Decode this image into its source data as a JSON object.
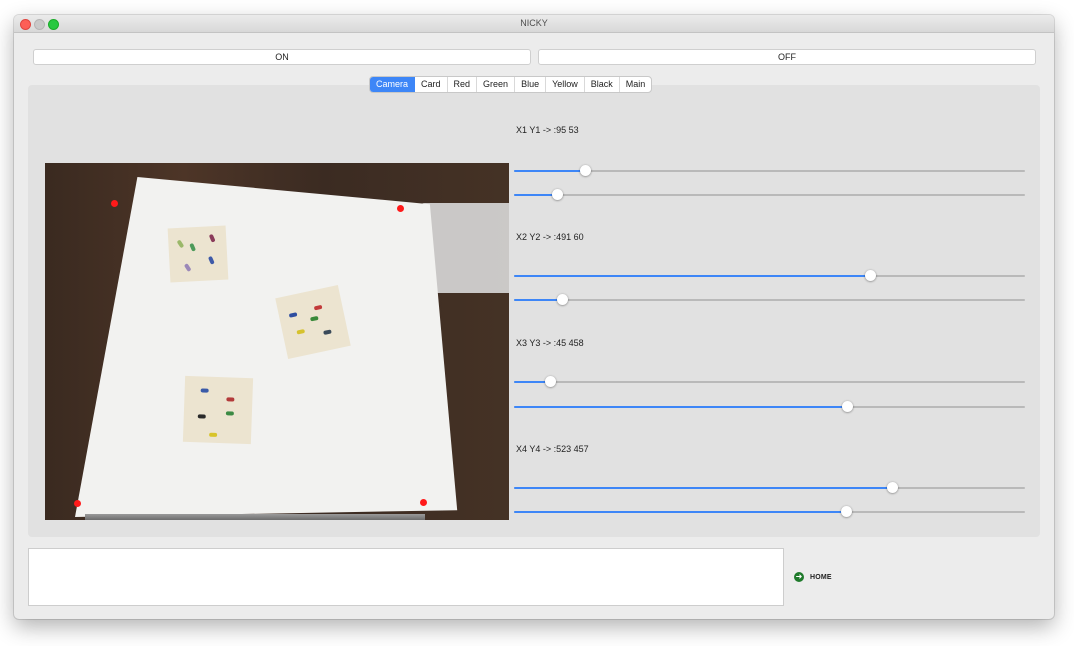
{
  "window": {
    "title": "NICKY"
  },
  "buttons": {
    "on_label": "ON",
    "off_label": "OFF"
  },
  "tabs": [
    {
      "label": "Camera",
      "active": true
    },
    {
      "label": "Card",
      "active": false
    },
    {
      "label": "Red",
      "active": false
    },
    {
      "label": "Green",
      "active": false
    },
    {
      "label": "Blue",
      "active": false
    },
    {
      "label": "Yellow",
      "active": false
    },
    {
      "label": "Black",
      "active": false
    },
    {
      "label": "Main",
      "active": false
    }
  ],
  "calibration": [
    {
      "label": "X1 Y1 -> :95 53",
      "slider_x": 0.14,
      "slider_y": 0.085
    },
    {
      "label": "X2 Y2 -> :491 60",
      "slider_x": 0.697,
      "slider_y": 0.095
    },
    {
      "label": "X3 Y3 -> :45 458",
      "slider_x": 0.072,
      "slider_y": 0.652
    },
    {
      "label": "X4 Y4 -> :523 457",
      "slider_x": 0.74,
      "slider_y": 0.65
    }
  ],
  "output": {
    "text": ""
  },
  "home": {
    "label": "HOME",
    "icon": "arrow-circle-right-icon"
  },
  "colors": {
    "accent": "#3d86f7",
    "marker": "#ff1a1a",
    "home_icon": "#1f7a2b"
  }
}
